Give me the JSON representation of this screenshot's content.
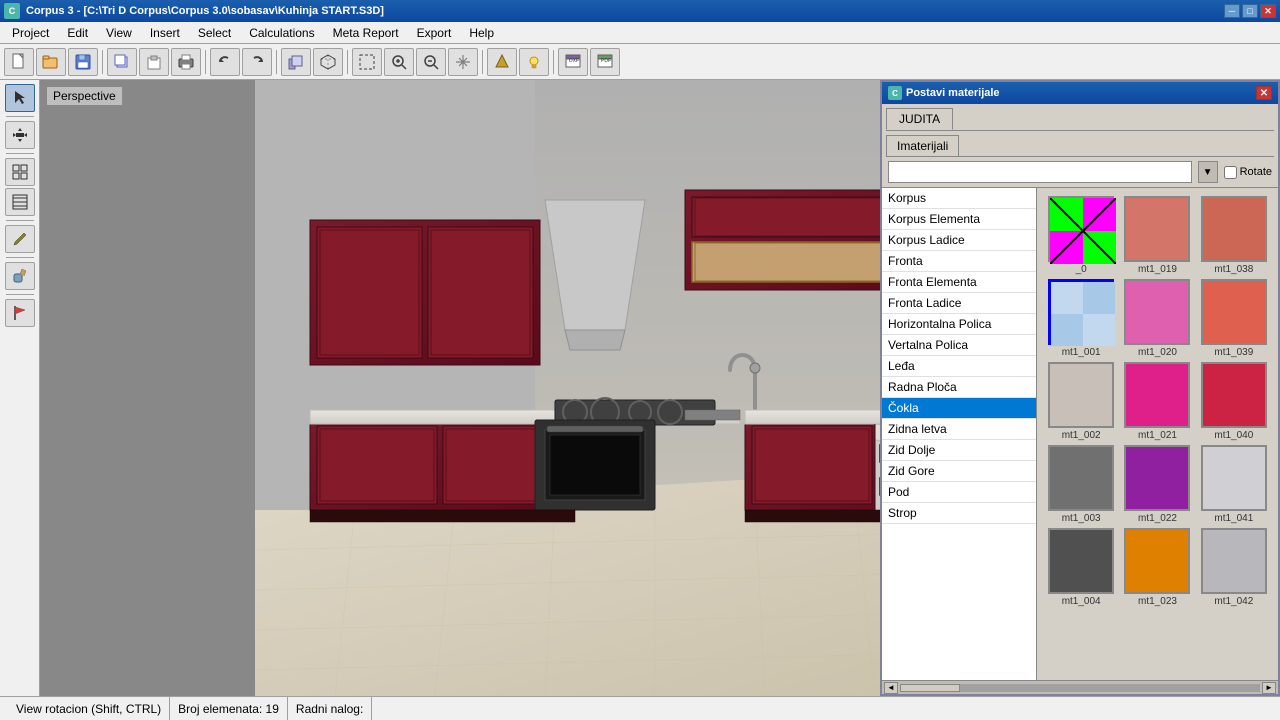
{
  "app": {
    "title": "Corpus 3 - [C:\\Tri D Corpus\\Corpus 3.0\\sobasav\\Kuhinja START.S3D]",
    "logo": "C"
  },
  "menubar": {
    "items": [
      "Project",
      "Edit",
      "View",
      "Insert",
      "Select",
      "Calculations",
      "Meta Report",
      "Export",
      "Help"
    ]
  },
  "toolbar": {
    "buttons": [
      {
        "name": "new",
        "icon": "📄"
      },
      {
        "name": "open",
        "icon": "📂"
      },
      {
        "name": "save",
        "icon": "💾"
      },
      {
        "name": "copy3d",
        "icon": "📋"
      },
      {
        "name": "paste3d",
        "icon": "📌"
      },
      {
        "name": "print",
        "icon": "🖨"
      },
      {
        "name": "undo",
        "icon": "↩"
      },
      {
        "name": "redo",
        "icon": "↪"
      },
      {
        "name": "arrange",
        "icon": "⬛"
      },
      {
        "name": "move",
        "icon": "✥"
      },
      {
        "name": "group",
        "icon": "▦"
      },
      {
        "name": "ungroup",
        "icon": "▤"
      },
      {
        "name": "zoom",
        "icon": "🔍"
      },
      {
        "name": "pan",
        "icon": "✋"
      },
      {
        "name": "render",
        "icon": "🎨"
      },
      {
        "name": "light",
        "icon": "💡"
      },
      {
        "name": "export1",
        "icon": "📤"
      },
      {
        "name": "export2",
        "icon": "📥"
      }
    ]
  },
  "leftTools": {
    "tools": [
      {
        "name": "select",
        "icon": "↖",
        "active": true
      },
      {
        "name": "move3d",
        "icon": "✥"
      },
      {
        "name": "grid",
        "icon": "▦"
      },
      {
        "name": "grid2",
        "icon": "▤"
      },
      {
        "name": "pencil",
        "icon": "✏"
      },
      {
        "name": "paint",
        "icon": "🪣"
      },
      {
        "name": "flag",
        "icon": "⚑"
      }
    ]
  },
  "viewport": {
    "label": "Perspective"
  },
  "dialog": {
    "title": "Postavi materijale",
    "logo": "C",
    "tabs": [
      "JUDITA"
    ],
    "subtabs": [
      "Imaterijali"
    ],
    "dropdown_placeholder": "",
    "rotate_label": "Rotate",
    "listItems": [
      {
        "label": "Korpus",
        "selected": false
      },
      {
        "label": "Korpus Elementa",
        "selected": false
      },
      {
        "label": "Korpus Ladice",
        "selected": false
      },
      {
        "label": "Fronta",
        "selected": false
      },
      {
        "label": "Fronta Elementa",
        "selected": false
      },
      {
        "label": "Fronta Ladice",
        "selected": false
      },
      {
        "label": "Horizontalna Polica",
        "selected": false
      },
      {
        "label": "Vertalna Polica",
        "selected": false
      },
      {
        "label": "Leđa",
        "selected": false
      },
      {
        "label": "Radna Ploča",
        "selected": false
      },
      {
        "label": "Čokla",
        "selected": true
      },
      {
        "label": "Zidna letva",
        "selected": false
      },
      {
        "label": "Zid Dolje",
        "selected": false
      },
      {
        "label": "Zid Gore",
        "selected": false
      },
      {
        "label": "Pod",
        "selected": false
      },
      {
        "label": "Strop",
        "selected": false
      }
    ],
    "colors": [
      {
        "id": "_0",
        "label": "_0",
        "color": "pattern",
        "selected": false
      },
      {
        "id": "mt1_019",
        "label": "mt1_019",
        "color": "#d4756a",
        "selected": false
      },
      {
        "id": "mt1_038",
        "label": "mt1_038",
        "color": "#cc6655",
        "selected": false
      },
      {
        "id": "mt1_001",
        "label": "mt1_001",
        "color": "#a8c8e8",
        "selected": true
      },
      {
        "id": "mt1_020",
        "label": "mt1_020",
        "color": "#e060b0",
        "selected": false
      },
      {
        "id": "mt1_039",
        "label": "mt1_039",
        "color": "#e06050",
        "selected": false
      },
      {
        "id": "mt1_002",
        "label": "mt1_002",
        "color": "#c8c0b8",
        "selected": false
      },
      {
        "id": "mt1_021",
        "label": "mt1_021",
        "color": "#e0208a",
        "selected": false
      },
      {
        "id": "mt1_040",
        "label": "mt1_040",
        "color": "#cc2244",
        "selected": false
      },
      {
        "id": "mt1_003",
        "label": "mt1_003",
        "color": "#707070",
        "selected": false
      },
      {
        "id": "mt1_022",
        "label": "mt1_022",
        "color": "#9020a0",
        "selected": false
      },
      {
        "id": "mt1_041",
        "label": "mt1_041",
        "color": "#d0d0d4",
        "selected": false
      },
      {
        "id": "mt1_004",
        "label": "mt1_004",
        "color": "#505050",
        "selected": false
      },
      {
        "id": "mt1_023",
        "label": "mt1_023",
        "color": "#e08000",
        "selected": false
      },
      {
        "id": "mt1_042",
        "label": "mt1_042",
        "color": "#b8b8bc",
        "selected": false
      }
    ]
  },
  "statusbar": {
    "view_rotation": "View rotacion (Shift, CTRL)",
    "elements": "Broj elemenata: 19",
    "work_order": "Radni nalog:"
  }
}
